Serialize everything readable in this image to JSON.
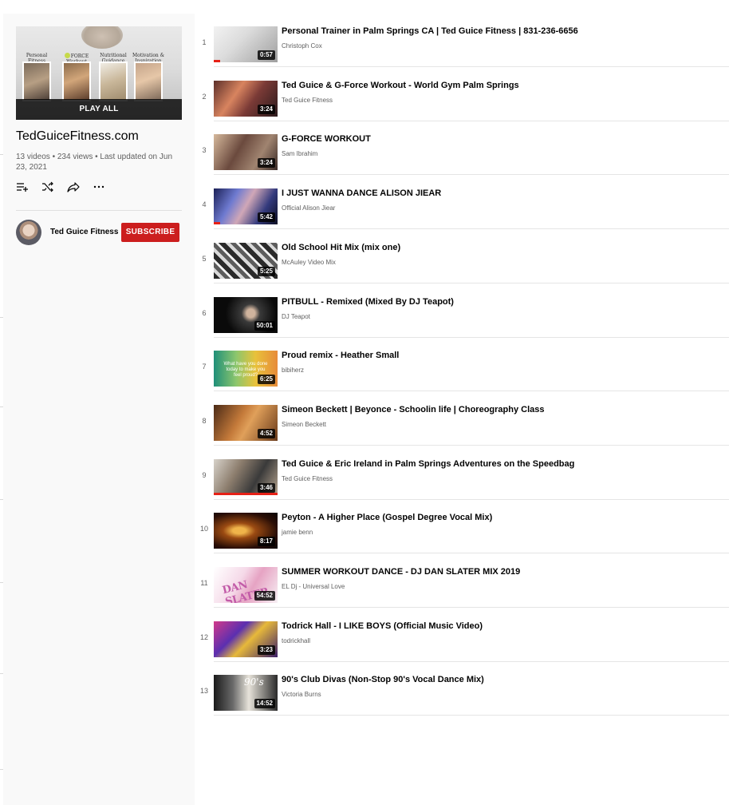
{
  "playlist": {
    "title": "TedGuiceFitness.com",
    "meta": "13 videos • 234 views • Last updated on Jun 23, 2021",
    "play_all_label": "PLAY ALL",
    "hero_captions": [
      "Personal Fitness Training",
      "FORCE Workout",
      "Nutritional Guidance",
      "Motivation & Inspiration"
    ],
    "actions": [
      {
        "icon": "add-to-queue-icon"
      },
      {
        "icon": "shuffle-icon"
      },
      {
        "icon": "share-icon"
      },
      {
        "icon": "more-icon"
      }
    ]
  },
  "owner": {
    "name": "Ted Guice Fitness",
    "subscribe_label": "SUBSCRIBE"
  },
  "colors": {
    "subscribe_bg": "#cc1e1e",
    "progress": "#e62117",
    "sidebar_bg": "#f9f9f9"
  },
  "videos": [
    {
      "index": "1",
      "title": "Personal Trainer in Palm Springs CA | Ted Guice Fitness | 831-236-6656",
      "channel": "Christoph Cox",
      "duration": "0:57",
      "watched": 0.1
    },
    {
      "index": "2",
      "title": "Ted Guice & G-Force Workout - World Gym Palm Springs",
      "channel": "Ted Guice Fitness",
      "duration": "3:24",
      "watched": 0
    },
    {
      "index": "3",
      "title": "G-FORCE WORKOUT",
      "channel": "Sam Ibrahim",
      "duration": "3:24",
      "watched": 0
    },
    {
      "index": "4",
      "title": "I JUST WANNA DANCE ALISON JIEAR",
      "channel": "Official Alison Jiear",
      "duration": "5:42",
      "watched": 0.1
    },
    {
      "index": "5",
      "title": "Old School Hit Mix (mix one)",
      "channel": "McAuley Video Mix",
      "duration": "5:25",
      "watched": 0
    },
    {
      "index": "6",
      "title": "PITBULL - Remixed (Mixed By DJ Teapot)",
      "channel": "DJ Teapot",
      "duration": "50:01",
      "watched": 0
    },
    {
      "index": "7",
      "title": "Proud remix - Heather Small",
      "channel": "bibiherz",
      "duration": "6:25",
      "watched": 0,
      "thumb_text": "What have you done today to make you feel proud?"
    },
    {
      "index": "8",
      "title": "Simeon Beckett  | Beyonce - Schoolin life  | Choreography Class",
      "channel": "Simeon Beckett",
      "duration": "4:52",
      "watched": 0
    },
    {
      "index": "9",
      "title": "Ted Guice & Eric Ireland in Palm Springs Adventures on the Speedbag",
      "channel": "Ted Guice Fitness",
      "duration": "3:46",
      "watched": 1.0
    },
    {
      "index": "10",
      "title": "Peyton - A Higher Place (Gospel Degree Vocal Mix)",
      "channel": "jamie benn",
      "duration": "8:17",
      "watched": 0
    },
    {
      "index": "11",
      "title": "SUMMER WORKOUT DANCE - DJ DAN SLATER MIX 2019",
      "channel": "EL Dj - Universal Love",
      "duration": "54:52",
      "watched": 0,
      "thumb_text": "DAN SLATER"
    },
    {
      "index": "12",
      "title": "Todrick Hall - I LIKE BOYS (Official Music Video)",
      "channel": "todrickhall",
      "duration": "3:23",
      "watched": 0
    },
    {
      "index": "13",
      "title": "90's Club Divas (Non-Stop 90's Vocal Dance Mix)",
      "channel": "Victoria Burns",
      "duration": "14:52",
      "watched": 0,
      "thumb_text": "90's"
    }
  ]
}
